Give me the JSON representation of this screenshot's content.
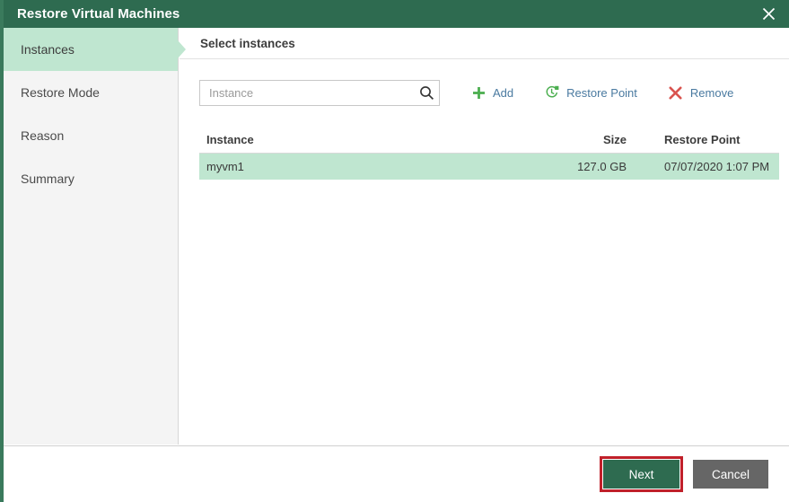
{
  "window": {
    "title": "Restore Virtual Machines",
    "close_icon": "close-icon",
    "titlebar_color": "#2e6b50"
  },
  "sidebar": {
    "items": [
      {
        "label": "Instances",
        "selected": true
      },
      {
        "label": "Restore Mode",
        "selected": false
      },
      {
        "label": "Reason",
        "selected": false
      },
      {
        "label": "Summary",
        "selected": false
      }
    ],
    "selected_color": "#bfe6d0",
    "background_color": "#f4f4f4"
  },
  "content": {
    "header": "Select instances",
    "search": {
      "placeholder": "Instance",
      "value": "",
      "icon": "search-icon"
    },
    "toolbar": {
      "buttons": [
        {
          "label": "Add",
          "icon": "plus-icon",
          "icon_color": "#4caf50"
        },
        {
          "label": "Restore Point",
          "icon": "restore-point-clock-icon",
          "icon_color": "#4caf50"
        },
        {
          "label": "Remove",
          "icon": "x-cross-icon",
          "icon_color": "#d9534f"
        }
      ],
      "label_color": "#4a7aa0"
    },
    "table": {
      "columns": [
        "Instance",
        "Size",
        "Restore Point"
      ],
      "rows": [
        {
          "instance": "myvm1",
          "size": "127.0 GB",
          "restore_point": "07/07/2020 1:07 PM",
          "selected": true
        }
      ],
      "selected_row_color": "#bfe6d0"
    }
  },
  "footer": {
    "next_label": "Next",
    "cancel_label": "Cancel",
    "next_color": "#2e6b50",
    "cancel_color": "#666666",
    "highlight_color": "#c0202a"
  }
}
